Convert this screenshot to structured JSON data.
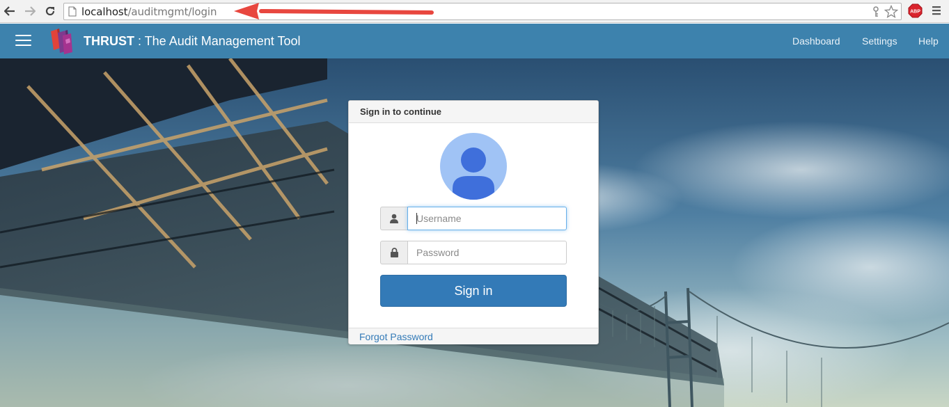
{
  "browser": {
    "url_host": "localhost",
    "url_path": "/auditmgmt/login",
    "abp_label": "ABP"
  },
  "header": {
    "brand": "THRUST",
    "tagline": " : The Audit Management Tool",
    "nav": [
      "Dashboard",
      "Settings",
      "Help"
    ]
  },
  "login": {
    "title": "Sign in to continue",
    "username_placeholder": "Username",
    "password_placeholder": "Password",
    "signin_label": "Sign in",
    "forgot_label": "Forgot Password"
  },
  "icons": {
    "back": "back-arrow-icon",
    "forward": "forward-arrow-icon",
    "reload": "reload-icon",
    "page": "page-icon",
    "key": "key-icon",
    "bookmark": "star-icon",
    "adblock": "abp-icon",
    "chrome_menu": "menu-icon",
    "hamburger": "hamburger-icon",
    "logo": "books-logo-icon",
    "avatar": "user-avatar-icon",
    "user": "user-icon",
    "lock": "lock-icon"
  },
  "colors": {
    "header_bg": "#3d82ad",
    "primary": "#337ab7",
    "avatar_bg": "#a0c3f5",
    "avatar_fg": "#3f6fdb",
    "annotation_arrow": "#e8473f"
  }
}
